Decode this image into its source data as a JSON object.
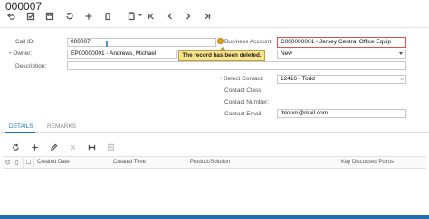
{
  "title": "000007",
  "toolbar": {
    "buttons": [
      "undo-icon",
      "save-close-icon",
      "save-icon",
      "cancel-icon",
      "add-icon",
      "delete-icon",
      "copy-paste-icon",
      "first-icon",
      "previous-icon",
      "next-icon",
      "last-icon"
    ]
  },
  "form": {
    "call_id_label": "Call ID:",
    "call_id_value": "000007",
    "owner_label": "Owner:",
    "owner_value": "EP00000001 - Andrews, Michael",
    "description_label": "Description:",
    "description_value": "",
    "business_account_label": "Business Account:",
    "business_account_value": "C000000001 - Jersey Central Office Equip",
    "status_value": "New",
    "select_contact_label": "Select Contact:",
    "select_contact_value": "12416 - Todd",
    "contact_class_label": "Contact Class:",
    "contact_number_label": "Contact Number:",
    "contact_email_label": "Contact Email:",
    "contact_email_value": "tbloom@mail.com"
  },
  "error_tooltip": "The record has been deleted.",
  "tabs": [
    {
      "label": "DETAILS",
      "active": true
    },
    {
      "label": "REMARKS",
      "active": false
    }
  ],
  "grid": {
    "columns": [
      "Created Date",
      "Created Time",
      "Product/Solution",
      "Key Discussed Points"
    ]
  },
  "colors": {
    "accent": "#1a75c4",
    "error_border": "#d9534f",
    "tooltip_bg": "#fbe58a",
    "footer_bar": "#1f6fb5"
  }
}
